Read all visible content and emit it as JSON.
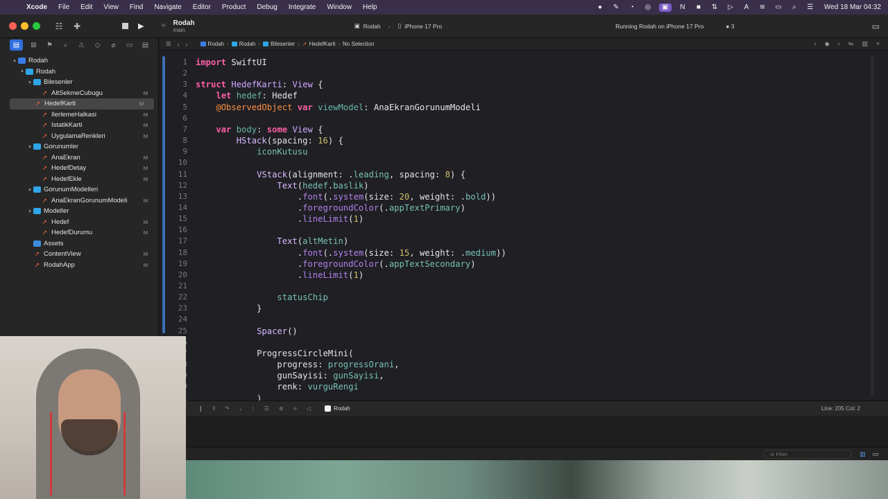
{
  "menubar": {
    "app": "Xcode",
    "items": [
      "File",
      "Edit",
      "View",
      "Find",
      "Navigate",
      "Editor",
      "Product",
      "Debug",
      "Integrate",
      "Window",
      "Help"
    ],
    "clock": "Wed 18 Mar  04:32"
  },
  "toolbar": {
    "project": "Rodah",
    "branch": "main",
    "scheme": "Rodah",
    "destination": "iPhone 17 Pro",
    "status": "Running Rodah on iPhone 17 Pro",
    "warnings": "3"
  },
  "navigator": {
    "tree": [
      {
        "label": "Rodah",
        "level": 0,
        "kind": "project",
        "disclosure": "▾",
        "badge": ""
      },
      {
        "label": "Rodah",
        "level": 1,
        "kind": "folder",
        "disclosure": "▾",
        "badge": ""
      },
      {
        "label": "Bilesenler",
        "level": 2,
        "kind": "folder",
        "disclosure": "▾",
        "badge": ""
      },
      {
        "label": "AltSekmeCubugu",
        "level": 3,
        "kind": "swift",
        "disclosure": "",
        "badge": "M"
      },
      {
        "label": "HedefKarti",
        "level": 3,
        "kind": "swift",
        "disclosure": "",
        "badge": "M",
        "selected": true
      },
      {
        "label": "IlerlemeHalkasi",
        "level": 3,
        "kind": "swift",
        "disclosure": "",
        "badge": "M"
      },
      {
        "label": "IstatikKarti",
        "level": 3,
        "kind": "swift",
        "disclosure": "",
        "badge": "M"
      },
      {
        "label": "UygulamaRenkleri",
        "level": 3,
        "kind": "swift",
        "disclosure": "",
        "badge": "M"
      },
      {
        "label": "Gorunumler",
        "level": 2,
        "kind": "folder",
        "disclosure": "▾",
        "badge": ""
      },
      {
        "label": "AnaEkran",
        "level": 3,
        "kind": "swift",
        "disclosure": "",
        "badge": "M"
      },
      {
        "label": "HedefDetay",
        "level": 3,
        "kind": "swift",
        "disclosure": "",
        "badge": "M"
      },
      {
        "label": "HedefEkle",
        "level": 3,
        "kind": "swift",
        "disclosure": "",
        "badge": "M"
      },
      {
        "label": "GorunumModelleri",
        "level": 2,
        "kind": "folder",
        "disclosure": "▾",
        "badge": ""
      },
      {
        "label": "AnaEkranGorunumModeli",
        "level": 3,
        "kind": "swift",
        "disclosure": "",
        "badge": "M"
      },
      {
        "label": "Modeller",
        "level": 2,
        "kind": "folder",
        "disclosure": "▾",
        "badge": ""
      },
      {
        "label": "Hedef",
        "level": 3,
        "kind": "swift",
        "disclosure": "",
        "badge": "M"
      },
      {
        "label": "HedefDurumu",
        "level": 3,
        "kind": "swift",
        "disclosure": "",
        "badge": "M"
      },
      {
        "label": "Assets",
        "level": 2,
        "kind": "assets",
        "disclosure": "",
        "badge": ""
      },
      {
        "label": "ContentView",
        "level": 2,
        "kind": "swift",
        "disclosure": "",
        "badge": "M"
      },
      {
        "label": "RodahApp",
        "level": 2,
        "kind": "swift",
        "disclosure": "",
        "badge": "M"
      }
    ]
  },
  "breadcrumbs": [
    "Rodah",
    "Rodah",
    "Bilesenler",
    "HedefKarti",
    "No Selection"
  ],
  "editor": {
    "lines": [
      {
        "n": "1",
        "t": [
          [
            "kw",
            "import"
          ],
          [
            "plain",
            " SwiftUI"
          ]
        ]
      },
      {
        "n": "2",
        "t": []
      },
      {
        "n": "3",
        "t": [
          [
            "kw",
            "struct"
          ],
          [
            "plain",
            " "
          ],
          [
            "ty",
            "HedefKarti"
          ],
          [
            "plain",
            ": "
          ],
          [
            "ty",
            "View"
          ],
          [
            "plain",
            " {"
          ]
        ]
      },
      {
        "n": "4",
        "t": [
          [
            "plain",
            "    "
          ],
          [
            "kw",
            "let"
          ],
          [
            "plain",
            " "
          ],
          [
            "prop",
            "hedef"
          ],
          [
            "plain",
            ": "
          ],
          [
            "plain",
            "Hedef"
          ]
        ]
      },
      {
        "n": "5",
        "t": [
          [
            "plain",
            "    "
          ],
          [
            "attr",
            "@ObservedObject"
          ],
          [
            "plain",
            " "
          ],
          [
            "kw",
            "var"
          ],
          [
            "plain",
            " "
          ],
          [
            "prop",
            "viewModel"
          ],
          [
            "plain",
            ": "
          ],
          [
            "plain",
            "AnaEkranGorunumModeli"
          ]
        ]
      },
      {
        "n": "6",
        "t": []
      },
      {
        "n": "7",
        "t": [
          [
            "plain",
            "    "
          ],
          [
            "kw",
            "var"
          ],
          [
            "plain",
            " "
          ],
          [
            "prop",
            "body"
          ],
          [
            "plain",
            ": "
          ],
          [
            "kw",
            "some"
          ],
          [
            "plain",
            " "
          ],
          [
            "ty",
            "View"
          ],
          [
            "plain",
            " {"
          ]
        ]
      },
      {
        "n": "8",
        "t": [
          [
            "plain",
            "        "
          ],
          [
            "ty2",
            "HStack"
          ],
          [
            "plain",
            "("
          ],
          [
            "plain",
            "spacing"
          ],
          [
            "plain",
            ": "
          ],
          [
            "num",
            "16"
          ],
          [
            "plain",
            ") {"
          ]
        ]
      },
      {
        "n": "9",
        "t": [
          [
            "plain",
            "            "
          ],
          [
            "mem",
            "iconKutusu"
          ]
        ]
      },
      {
        "n": "10",
        "t": []
      },
      {
        "n": "11",
        "t": [
          [
            "plain",
            "            "
          ],
          [
            "ty2",
            "VStack"
          ],
          [
            "plain",
            "(alignment: ."
          ],
          [
            "mem",
            "leading"
          ],
          [
            "plain",
            ", spacing: "
          ],
          [
            "num",
            "8"
          ],
          [
            "plain",
            ") {"
          ]
        ]
      },
      {
        "n": "12",
        "t": [
          [
            "plain",
            "                "
          ],
          [
            "ty2",
            "Text"
          ],
          [
            "plain",
            "("
          ],
          [
            "mem",
            "hedef"
          ],
          [
            "plain",
            "."
          ],
          [
            "mem",
            "baslik"
          ],
          [
            "plain",
            ")"
          ]
        ]
      },
      {
        "n": "13",
        "t": [
          [
            "plain",
            "                    ."
          ],
          [
            "fnc",
            "font"
          ],
          [
            "plain",
            "(."
          ],
          [
            "fnc",
            "system"
          ],
          [
            "plain",
            "(size: "
          ],
          [
            "num",
            "20"
          ],
          [
            "plain",
            ", weight: ."
          ],
          [
            "mem",
            "bold"
          ],
          [
            "plain",
            "))"
          ]
        ]
      },
      {
        "n": "14",
        "t": [
          [
            "plain",
            "                    ."
          ],
          [
            "fnc",
            "foregroundColor"
          ],
          [
            "plain",
            "(."
          ],
          [
            "mem",
            "appTextPrimary"
          ],
          [
            "plain",
            ")"
          ]
        ]
      },
      {
        "n": "15",
        "t": [
          [
            "plain",
            "                    ."
          ],
          [
            "fnc",
            "lineLimit"
          ],
          [
            "plain",
            "("
          ],
          [
            "num",
            "1"
          ],
          [
            "plain",
            ")"
          ]
        ]
      },
      {
        "n": "16",
        "t": []
      },
      {
        "n": "17",
        "t": [
          [
            "plain",
            "                "
          ],
          [
            "ty2",
            "Text"
          ],
          [
            "plain",
            "("
          ],
          [
            "mem",
            "altMetin"
          ],
          [
            "plain",
            ")"
          ]
        ]
      },
      {
        "n": "18",
        "t": [
          [
            "plain",
            "                    ."
          ],
          [
            "fnc",
            "font"
          ],
          [
            "plain",
            "(."
          ],
          [
            "fnc",
            "system"
          ],
          [
            "plain",
            "(size: "
          ],
          [
            "num",
            "15"
          ],
          [
            "plain",
            ", weight: ."
          ],
          [
            "mem",
            "medium"
          ],
          [
            "plain",
            "))"
          ]
        ]
      },
      {
        "n": "19",
        "t": [
          [
            "plain",
            "                    ."
          ],
          [
            "fnc",
            "foregroundColor"
          ],
          [
            "plain",
            "(."
          ],
          [
            "mem",
            "appTextSecondary"
          ],
          [
            "plain",
            ")"
          ]
        ]
      },
      {
        "n": "20",
        "t": [
          [
            "plain",
            "                    ."
          ],
          [
            "fnc",
            "lineLimit"
          ],
          [
            "plain",
            "("
          ],
          [
            "num",
            "1"
          ],
          [
            "plain",
            ")"
          ]
        ]
      },
      {
        "n": "21",
        "t": []
      },
      {
        "n": "22",
        "t": [
          [
            "plain",
            "                "
          ],
          [
            "mem",
            "statusChip"
          ]
        ]
      },
      {
        "n": "23",
        "t": [
          [
            "plain",
            "            }"
          ]
        ]
      },
      {
        "n": "24",
        "t": []
      },
      {
        "n": "25",
        "t": [
          [
            "plain",
            "            "
          ],
          [
            "ty2",
            "Spacer"
          ],
          [
            "plain",
            "()"
          ]
        ]
      },
      {
        "n": "26",
        "t": []
      },
      {
        "n": "27",
        "t": [
          [
            "plain",
            "            "
          ],
          [
            "plain",
            "ProgressCircleMini("
          ]
        ]
      },
      {
        "n": "28",
        "t": [
          [
            "plain",
            "                progress: "
          ],
          [
            "mem",
            "progressOrani"
          ],
          [
            "plain",
            ","
          ]
        ]
      },
      {
        "n": "29",
        "t": [
          [
            "plain",
            "                gunSayisi: "
          ],
          [
            "mem",
            "gunSayisi"
          ],
          [
            "plain",
            ","
          ]
        ]
      },
      {
        "n": "30",
        "t": [
          [
            "plain",
            "                renk: "
          ],
          [
            "mem",
            "vurguRengi"
          ]
        ]
      },
      {
        "n": "31",
        "t": [
          [
            "plain",
            "            )"
          ]
        ]
      }
    ]
  },
  "debug": {
    "process": "Rodah",
    "position": "Line: 205  Col: 2",
    "filter_placeholder": "Filter"
  },
  "colors": {
    "accent": "#2f6fe0",
    "keyword": "#fc5fa3",
    "type": "#d0a8ff",
    "number": "#d0bf69"
  }
}
